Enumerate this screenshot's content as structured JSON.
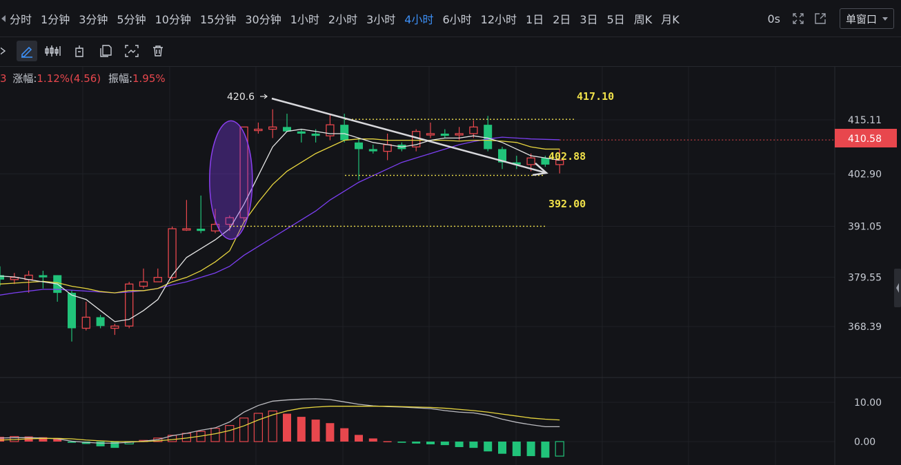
{
  "toolbar": {
    "periods": [
      "分时",
      "1分钟",
      "3分钟",
      "5分钟",
      "10分钟",
      "15分钟",
      "30分钟",
      "1小时",
      "2小时",
      "3小时",
      "4小时",
      "6小时",
      "12小时",
      "1日",
      "2日",
      "3日",
      "5日",
      "周K",
      "月K"
    ],
    "active_period": "4小时",
    "countdown": "0s",
    "window_mode": "单窗口"
  },
  "info_bar": {
    "lead": "3",
    "change_label": "涨幅:",
    "change_value": "1.12%(4.56)",
    "amplitude_label": "振幅:",
    "amplitude_value": "1.95%"
  },
  "colors": {
    "up": "#e8474d",
    "down": "#21c37a",
    "ma5": "#e6e6e6",
    "ma10": "#e8d63f",
    "ma30": "#7b3ff2",
    "annotation": "#f0e14a",
    "background": "#131418"
  },
  "chart_data": {
    "type": "candlestick",
    "price_axis": {
      "ticks": [
        415.11,
        402.9,
        391.05,
        379.55,
        368.39
      ],
      "current_price": 410.58
    },
    "candles": [
      {
        "o": 380.0,
        "h": 382.0,
        "l": 377.5,
        "c": 379.0
      },
      {
        "o": 379.0,
        "h": 380.5,
        "l": 378.0,
        "c": 379.5
      },
      {
        "o": 379.0,
        "h": 381.0,
        "l": 376.0,
        "c": 380.0
      },
      {
        "o": 380.0,
        "h": 381.0,
        "l": 377.0,
        "c": 379.5
      },
      {
        "o": 380.0,
        "h": 380.0,
        "l": 374.0,
        "c": 376.0
      },
      {
        "o": 376.0,
        "h": 376.5,
        "l": 365.0,
        "c": 368.0
      },
      {
        "o": 368.0,
        "h": 374.0,
        "l": 367.5,
        "c": 370.5
      },
      {
        "o": 370.5,
        "h": 371.0,
        "l": 368.0,
        "c": 368.5
      },
      {
        "o": 368.0,
        "h": 369.0,
        "l": 366.5,
        "c": 368.5
      },
      {
        "o": 368.5,
        "h": 378.5,
        "l": 368.0,
        "c": 378.0
      },
      {
        "o": 377.5,
        "h": 381.5,
        "l": 377.0,
        "c": 378.5
      },
      {
        "o": 378.5,
        "h": 381.5,
        "l": 378.5,
        "c": 379.5
      },
      {
        "o": 379.5,
        "h": 391.0,
        "l": 379.0,
        "c": 390.5
      },
      {
        "o": 390.5,
        "h": 397.0,
        "l": 390.0,
        "c": 390.5
      },
      {
        "o": 390.5,
        "h": 398.0,
        "l": 389.5,
        "c": 390.0
      },
      {
        "o": 390.0,
        "h": 395.0,
        "l": 389.5,
        "c": 391.5
      },
      {
        "o": 391.5,
        "h": 393.5,
        "l": 390.0,
        "c": 393.0
      },
      {
        "o": 393.0,
        "h": 413.5,
        "l": 392.0,
        "c": 413.5
      },
      {
        "o": 413.0,
        "h": 414.5,
        "l": 412.0,
        "c": 413.0
      },
      {
        "o": 413.0,
        "h": 417.5,
        "l": 411.0,
        "c": 413.5
      },
      {
        "o": 413.5,
        "h": 416.5,
        "l": 412.5,
        "c": 412.5
      },
      {
        "o": 412.5,
        "h": 413.0,
        "l": 410.0,
        "c": 412.0
      },
      {
        "o": 412.0,
        "h": 413.0,
        "l": 410.0,
        "c": 411.5
      },
      {
        "o": 411.5,
        "h": 416.5,
        "l": 410.5,
        "c": 414.0
      },
      {
        "o": 414.0,
        "h": 416.5,
        "l": 410.0,
        "c": 410.5
      },
      {
        "o": 410.0,
        "h": 411.0,
        "l": 401.5,
        "c": 408.5
      },
      {
        "o": 408.5,
        "h": 409.5,
        "l": 407.5,
        "c": 408.0
      },
      {
        "o": 408.0,
        "h": 412.0,
        "l": 406.0,
        "c": 409.5
      },
      {
        "o": 409.5,
        "h": 410.0,
        "l": 408.0,
        "c": 408.5
      },
      {
        "o": 409.0,
        "h": 413.0,
        "l": 408.0,
        "c": 412.5
      },
      {
        "o": 412.0,
        "h": 414.5,
        "l": 411.0,
        "c": 412.0
      },
      {
        "o": 412.0,
        "h": 413.0,
        "l": 411.0,
        "c": 411.5
      },
      {
        "o": 412.0,
        "h": 413.5,
        "l": 410.5,
        "c": 412.0
      },
      {
        "o": 412.0,
        "h": 415.0,
        "l": 411.0,
        "c": 413.5
      },
      {
        "o": 414.0,
        "h": 416.0,
        "l": 408.0,
        "c": 408.5
      },
      {
        "o": 408.5,
        "h": 409.0,
        "l": 404.0,
        "c": 405.5
      },
      {
        "o": 405.5,
        "h": 407.0,
        "l": 404.0,
        "c": 405.0
      },
      {
        "o": 405.0,
        "h": 407.5,
        "l": 403.5,
        "c": 406.5
      },
      {
        "o": 406.5,
        "h": 407.0,
        "l": 404.5,
        "c": 405.0
      },
      {
        "o": 405.0,
        "h": 408.5,
        "l": 403.0,
        "c": 406.0
      }
    ],
    "ma5": [
      379.8,
      379.6,
      379.0,
      378.5,
      378.0,
      375.5,
      374.5,
      372.0,
      369.5,
      370.0,
      372.0,
      374.5,
      380.0,
      384.0,
      386.0,
      388.0,
      390.5,
      396.0,
      402.5,
      409.0,
      412.5,
      413.0,
      412.5,
      412.0,
      412.0,
      411.0,
      410.0,
      409.5,
      409.0,
      409.5,
      410.5,
      411.0,
      411.0,
      411.5,
      411.0,
      410.0,
      408.5,
      407.0,
      406.5,
      406.0
    ],
    "ma10": [
      378.0,
      378.2,
      378.4,
      378.6,
      378.3,
      377.5,
      377.0,
      376.3,
      376.0,
      376.5,
      376.5,
      377.0,
      378.5,
      379.5,
      381.0,
      383.0,
      385.5,
      392.0,
      396.5,
      400.5,
      403.5,
      405.5,
      407.5,
      409.0,
      410.5,
      410.8,
      410.8,
      410.5,
      410.5,
      410.5,
      410.5,
      410.5,
      410.3,
      410.5,
      410.5,
      410.3,
      410.0,
      409.0,
      408.5,
      408.5
    ],
    "ma30": [
      375.5,
      376.0,
      376.4,
      376.8,
      376.8,
      376.6,
      376.4,
      376.2,
      376.0,
      376.2,
      376.5,
      377.0,
      377.8,
      378.5,
      379.5,
      380.5,
      382.0,
      384.5,
      386.5,
      388.5,
      390.5,
      392.5,
      394.5,
      397.0,
      399.0,
      401.0,
      402.5,
      404.0,
      405.5,
      406.5,
      407.5,
      408.5,
      409.5,
      410.2,
      410.8,
      411.2,
      411.0,
      410.8,
      410.7,
      410.6
    ],
    "annotations": {
      "peak_label": "420.6",
      "resistance": {
        "label": "417.10",
        "value": 417.1
      },
      "mid": {
        "label": "402.88",
        "value": 402.88
      },
      "support": {
        "label": "392.00",
        "value": 392.0
      },
      "trendline_from": {
        "index": 19,
        "price": 418.5
      },
      "trendline_to": {
        "index": 39,
        "price": 402.5
      }
    },
    "macd": {
      "axis_ticks": [
        10.0,
        0.0
      ],
      "histogram": [
        1.2,
        1.3,
        1.3,
        1.1,
        0.9,
        -0.3,
        -0.6,
        -1.2,
        -1.6,
        -0.6,
        0.3,
        0.9,
        1.6,
        2.1,
        2.6,
        3.4,
        4.1,
        6.0,
        7.2,
        7.8,
        7.1,
        6.3,
        5.6,
        4.7,
        3.4,
        1.7,
        0.8,
        0.1,
        -0.3,
        -0.5,
        -0.7,
        -0.9,
        -1.4,
        -1.6,
        -2.5,
        -3.1,
        -3.7,
        -3.7,
        -4.1,
        -3.7
      ],
      "dif": [
        0.9,
        1.0,
        1.0,
        0.9,
        0.7,
        0.1,
        -0.2,
        -0.4,
        -0.4,
        -0.2,
        0.1,
        0.5,
        1.5,
        2.1,
        2.9,
        3.5,
        5.0,
        7.5,
        9.2,
        10.3,
        10.6,
        10.8,
        10.9,
        10.7,
        10.1,
        9.5,
        9.1,
        8.9,
        8.8,
        8.6,
        8.4,
        7.9,
        7.5,
        7.3,
        6.7,
        5.7,
        4.9,
        4.3,
        3.8,
        3.8
      ],
      "dea": [
        0.4,
        0.5,
        0.7,
        0.8,
        0.8,
        0.7,
        0.4,
        0.2,
        0.0,
        0.0,
        0.0,
        0.2,
        0.5,
        0.9,
        1.4,
        2.0,
        2.8,
        4.0,
        5.5,
        6.8,
        7.8,
        8.5,
        8.8,
        9.0,
        9.0,
        9.0,
        9.0,
        9.0,
        8.9,
        8.8,
        8.7,
        8.5,
        8.2,
        7.9,
        7.5,
        7.0,
        6.5,
        6.0,
        5.7,
        5.5
      ]
    }
  }
}
